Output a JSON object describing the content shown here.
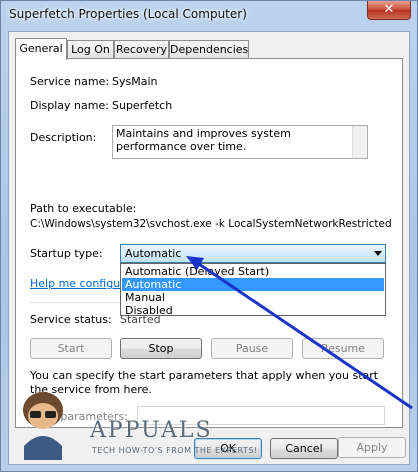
{
  "window": {
    "title": "Superfetch Properties (Local Computer)",
    "close_glyph": "✕"
  },
  "tabs": [
    {
      "label": "General"
    },
    {
      "label": "Log On"
    },
    {
      "label": "Recovery"
    },
    {
      "label": "Dependencies"
    }
  ],
  "general": {
    "service_name_label": "Service name:",
    "service_name": "SysMain",
    "display_name_label": "Display name:",
    "display_name": "Superfetch",
    "description_label": "Description:",
    "description": "Maintains and improves system performance over time.",
    "path_label": "Path to executable:",
    "path": "C:\\Windows\\system32\\svchost.exe -k LocalSystemNetworkRestricted",
    "startup_type_label": "Startup type:",
    "startup_type_value": "Automatic",
    "startup_options": [
      "Automatic (Delayed Start)",
      "Automatic",
      "Manual",
      "Disabled"
    ],
    "help_link": "Help me configure s",
    "service_status_label": "Service status:",
    "service_status": "Started",
    "start_label": "Start",
    "stop_label": "Stop",
    "pause_label": "Pause",
    "resume_label": "Resume",
    "info_text": "You can specify the start parameters that apply when you start the service from here.",
    "start_params_label": "Start parameters:"
  },
  "footer": {
    "ok_label": "OK",
    "cancel_label": "Cancel",
    "apply_label": "Apply"
  },
  "watermark": {
    "brand": "APPUALS",
    "tagline": "TECH HOW-TO'S FROM THE EXPERTS!"
  },
  "colors": {
    "annotation_arrow": "#1a33c8",
    "selection": "#3399ff",
    "link": "#0066cc"
  }
}
